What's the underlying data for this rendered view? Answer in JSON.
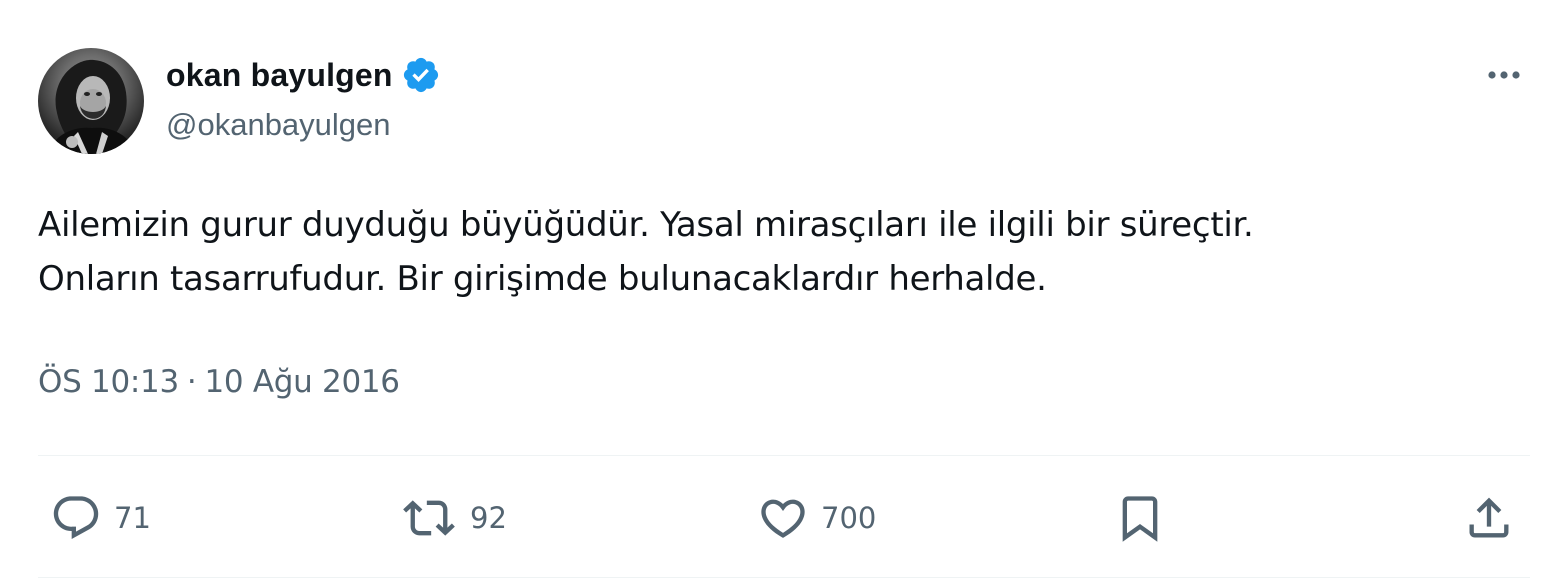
{
  "author": {
    "display_name": "okan bayulgen",
    "handle": "@okanbayulgen",
    "verified": true
  },
  "tweet": {
    "text": "Ailemizin gurur duyduğu büyüğüdür. Yasal mirasçıları ile ilgili bir süreçtir.\nOnların tasarrufudur. Bir girişimde bulunacaklardır herhalde.",
    "time": "ÖS 10:13",
    "separator": "·",
    "date": "10 Ağu 2016"
  },
  "actions": {
    "replies": "71",
    "retweets": "92",
    "likes": "700"
  },
  "icons": {
    "verified": "verified-badge-icon",
    "more": "more-dots-icon",
    "reply": "speech-bubble-icon",
    "retweet": "retweet-arrows-icon",
    "like": "heart-icon",
    "bookmark": "bookmark-icon",
    "share": "share-upload-icon"
  },
  "colors": {
    "accent": "#1d9bf0",
    "text": "#0f1419",
    "secondary": "#536471",
    "divider": "#eff3f4"
  }
}
